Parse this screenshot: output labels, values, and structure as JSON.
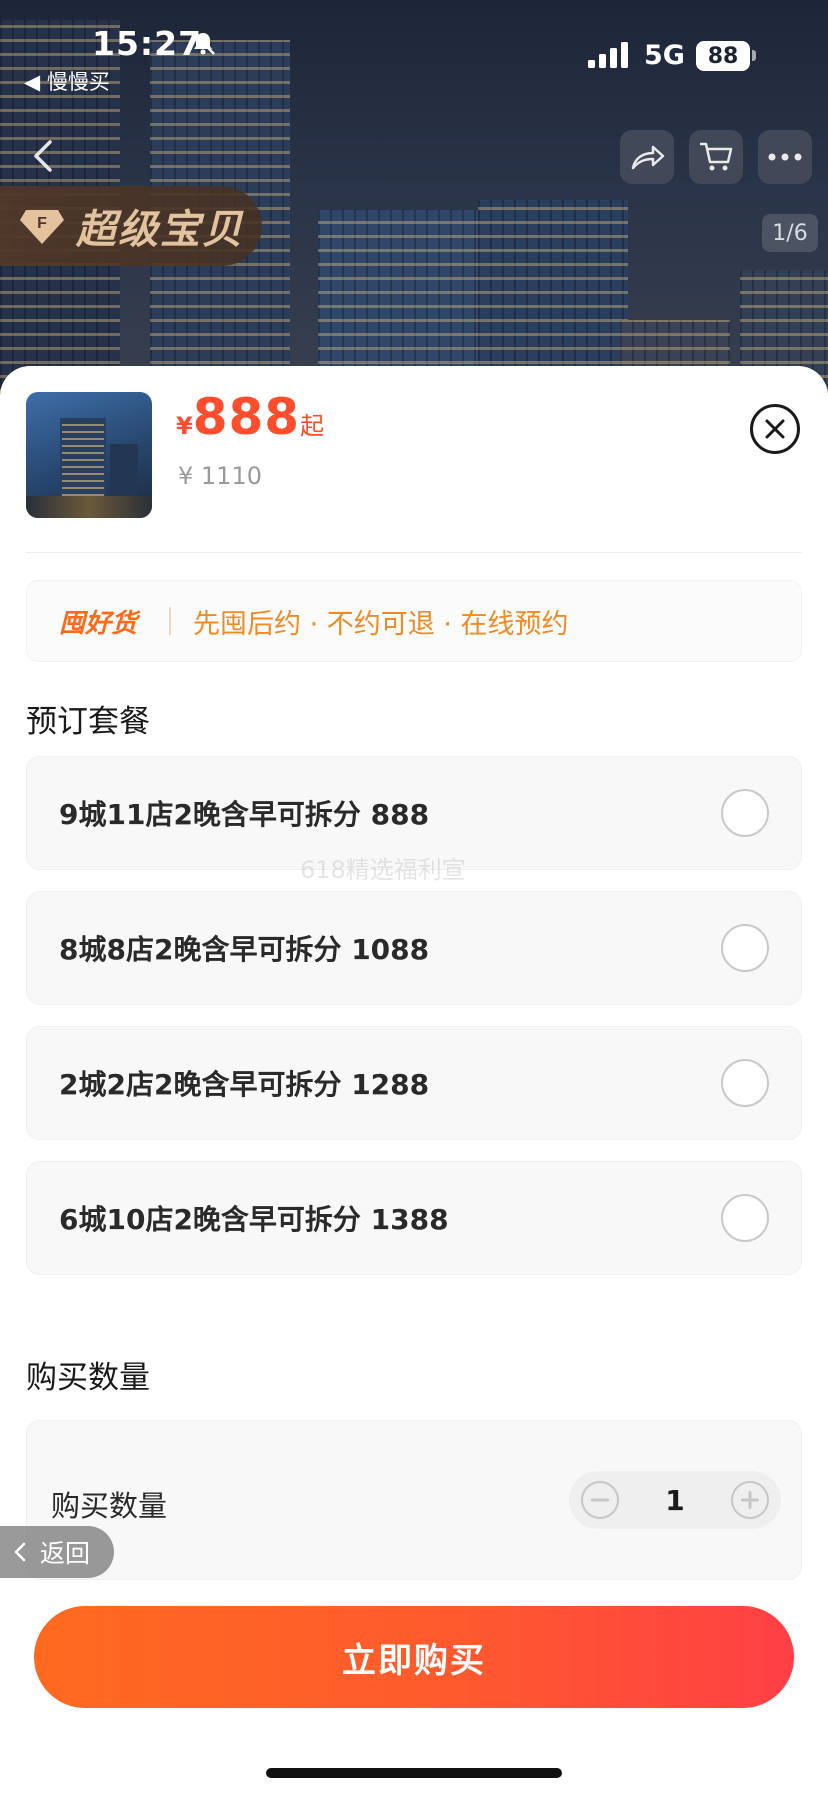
{
  "status_bar": {
    "time": "15:27",
    "back_app": "◀ 慢慢买",
    "network": "5G",
    "battery": "88"
  },
  "hero": {
    "badge_text": "超级宝贝",
    "page_indicator": "1/6"
  },
  "product": {
    "price_symbol": "¥",
    "price": "888",
    "price_suffix": "起",
    "original_price": "¥ 1110"
  },
  "promo": {
    "tag": "囤好货",
    "description": "先囤后约 · 不约可退 · 在线预约"
  },
  "package_section": {
    "title": "预订套餐",
    "options": [
      {
        "label": "9城11店2晚含早可拆分 888"
      },
      {
        "label": "8城8店2晚含早可拆分 1088"
      },
      {
        "label": "2城2店2晚含早可拆分 1288"
      },
      {
        "label": "6城10店2晚含早可拆分 1388"
      }
    ]
  },
  "watermark": "618精选福利宣",
  "quantity_section": {
    "title": "购买数量",
    "label": "购买数量",
    "value": "1"
  },
  "floating_back": "返回",
  "buy_button": "立即购买",
  "colors": {
    "accent": "#ff4d2d",
    "promo_text": "#f28a24",
    "button_start": "#ff6a1f",
    "button_end": "#ff3f45"
  }
}
